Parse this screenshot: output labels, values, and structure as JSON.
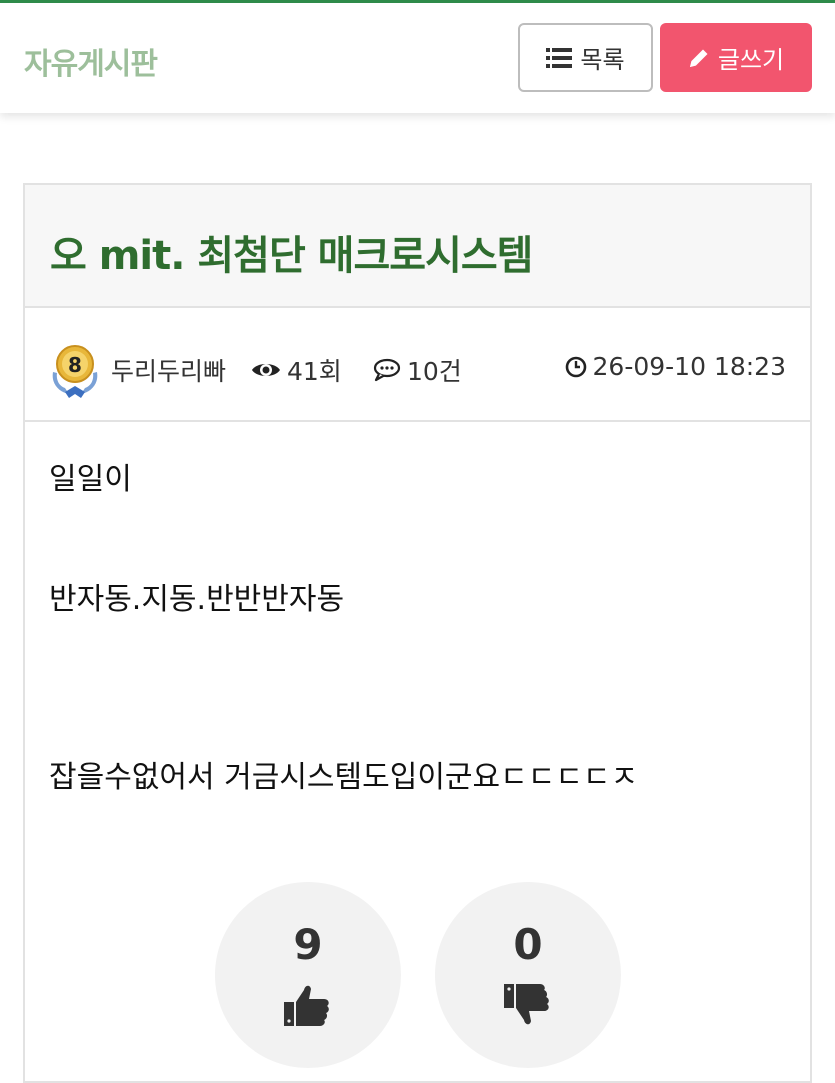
{
  "header": {
    "board_title": "자유게시판",
    "list_button_label": "목록",
    "write_button_label": "글쓰기"
  },
  "post": {
    "title": "오 mit. 최첨단 매크로시스템",
    "author": "두리두리빠",
    "level_badge": "8",
    "views": "41회",
    "comments": "10건",
    "datetime": "26-09-10 18:23",
    "body_lines": [
      "일일이",
      "반자동.지동.반반반자동",
      "잡을수없어서 거금시스템도입이군요ㄷㄷㄷㄷㅈ"
    ]
  },
  "votes": {
    "likes": "9",
    "dislikes": "0"
  },
  "colors": {
    "accent_green": "#2e8b4a",
    "title_green": "#2f6d2f",
    "board_title_green": "#9dbf9b",
    "write_button": "#f2556e"
  },
  "icons": {
    "list": "list-icon",
    "write": "pencil-icon",
    "views": "eye-icon",
    "comments": "comment-icon",
    "datetime": "clock-icon",
    "like": "thumbs-up-icon",
    "dislike": "thumbs-down-icon"
  }
}
